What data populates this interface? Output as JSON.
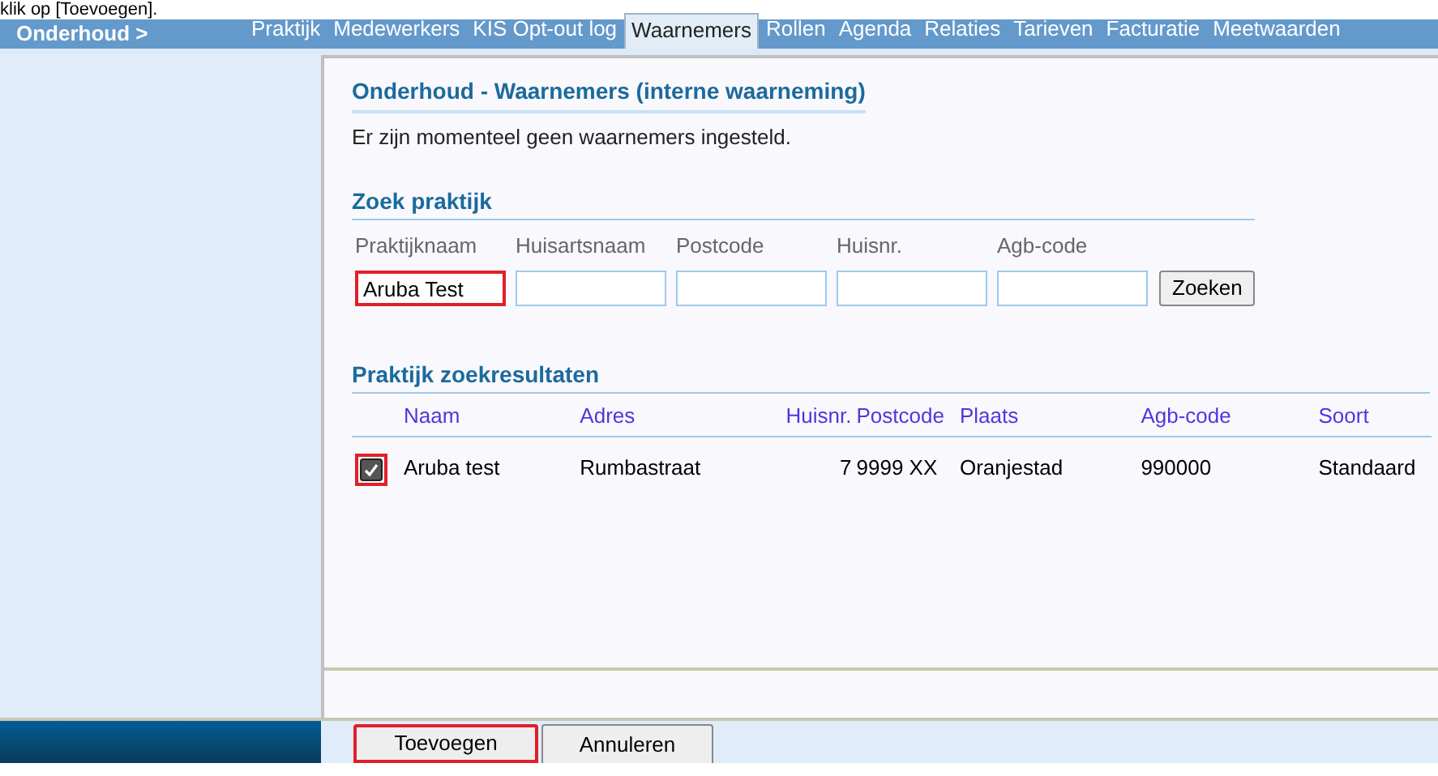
{
  "caption": "klik op [Toevoegen].",
  "nav": {
    "title": "Onderhoud >",
    "tabs": [
      {
        "label": "Praktijk",
        "selected": false
      },
      {
        "label": "Medewerkers",
        "selected": false
      },
      {
        "label": "KIS Opt-out log",
        "selected": false
      },
      {
        "label": "Waarnemers",
        "selected": true
      },
      {
        "label": "Rollen",
        "selected": false
      },
      {
        "label": "Agenda",
        "selected": false
      },
      {
        "label": "Relaties",
        "selected": false
      },
      {
        "label": "Tarieven",
        "selected": false
      },
      {
        "label": "Facturatie",
        "selected": false
      },
      {
        "label": "Meetwaarden",
        "selected": false
      }
    ]
  },
  "page": {
    "title": "Onderhoud - Waarnemers (interne waarneming)",
    "message": "Er zijn momenteel geen waarnemers ingesteld."
  },
  "search": {
    "title": "Zoek praktijk",
    "fields": [
      {
        "label": "Praktijknaam",
        "value": "Aruba Test",
        "highlighted": true
      },
      {
        "label": "Huisartsnaam",
        "highlighted": false
      },
      {
        "label": "Postcode",
        "highlighted": false
      },
      {
        "label": "Huisnr.",
        "highlighted": false
      },
      {
        "label": "Agb-code",
        "highlighted": false
      }
    ],
    "button": "Zoeken"
  },
  "results": {
    "title": "Praktijk zoekresultaten",
    "columns": [
      "Naam",
      "Adres",
      "Huisnr.",
      "Postcode",
      "Plaats",
      "Agb-code",
      "Soort"
    ],
    "rows": [
      {
        "checked": true,
        "highlighted": true,
        "cells": [
          "Aruba test",
          "Rumbastraat",
          "7",
          "9999 XX",
          "Oranjestad",
          "990000",
          "Standaard"
        ]
      }
    ]
  },
  "buttons": [
    {
      "label": "Toevoegen",
      "highlighted": true
    },
    {
      "label": "Annuleren",
      "highlighted": false
    }
  ]
}
